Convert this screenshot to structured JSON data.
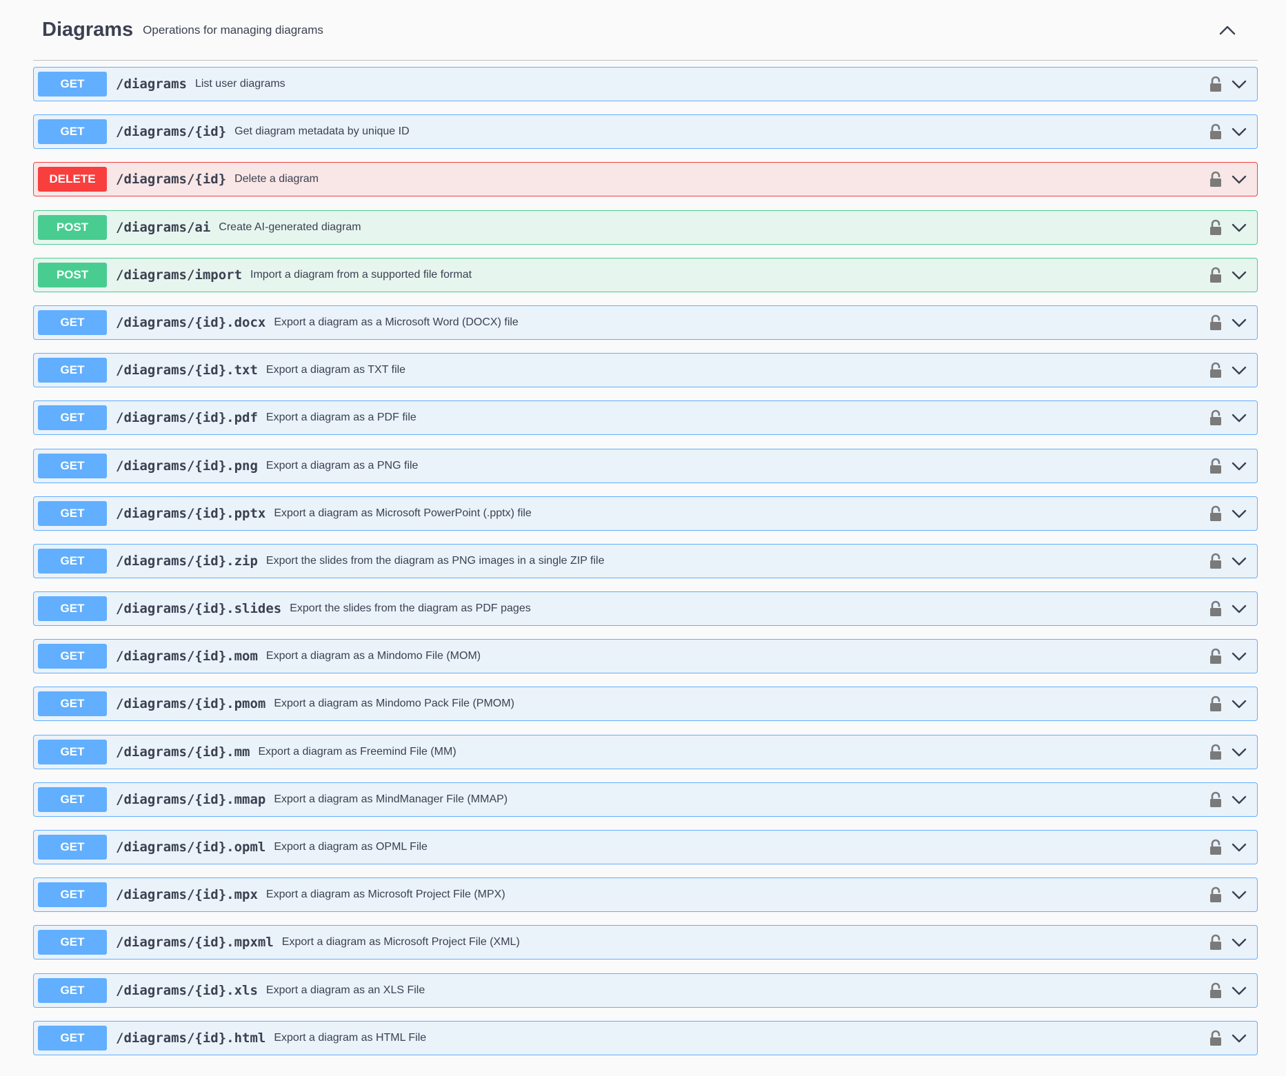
{
  "section": {
    "title": "Diagrams",
    "description": "Operations for managing diagrams"
  },
  "colors": {
    "get": "#61affe",
    "delete": "#f93e3e",
    "post": "#49cc90",
    "text": "#3b4151"
  },
  "operations": [
    {
      "method": "GET",
      "path": "/diagrams",
      "summary": "List user diagrams"
    },
    {
      "method": "GET",
      "path": "/diagrams/{id}",
      "summary": "Get diagram metadata by unique ID"
    },
    {
      "method": "DELETE",
      "path": "/diagrams/{id}",
      "summary": "Delete a diagram"
    },
    {
      "method": "POST",
      "path": "/diagrams/ai",
      "summary": "Create AI-generated diagram"
    },
    {
      "method": "POST",
      "path": "/diagrams/import",
      "summary": "Import a diagram from a supported file format"
    },
    {
      "method": "GET",
      "path": "/diagrams/{id}.docx",
      "summary": "Export a diagram as a Microsoft Word (DOCX) file"
    },
    {
      "method": "GET",
      "path": "/diagrams/{id}.txt",
      "summary": "Export a diagram as TXT file"
    },
    {
      "method": "GET",
      "path": "/diagrams/{id}.pdf",
      "summary": "Export a diagram as a PDF file"
    },
    {
      "method": "GET",
      "path": "/diagrams/{id}.png",
      "summary": "Export a diagram as a PNG file"
    },
    {
      "method": "GET",
      "path": "/diagrams/{id}.pptx",
      "summary": "Export a diagram as Microsoft PowerPoint (.pptx) file"
    },
    {
      "method": "GET",
      "path": "/diagrams/{id}.zip",
      "summary": "Export the slides from the diagram as PNG images in a single ZIP file"
    },
    {
      "method": "GET",
      "path": "/diagrams/{id}.slides",
      "summary": "Export the slides from the diagram as PDF pages"
    },
    {
      "method": "GET",
      "path": "/diagrams/{id}.mom",
      "summary": "Export a diagram as a Mindomo File (MOM)"
    },
    {
      "method": "GET",
      "path": "/diagrams/{id}.pmom",
      "summary": "Export a diagram as Mindomo Pack File (PMOM)"
    },
    {
      "method": "GET",
      "path": "/diagrams/{id}.mm",
      "summary": "Export a diagram as Freemind File (MM)"
    },
    {
      "method": "GET",
      "path": "/diagrams/{id}.mmap",
      "summary": "Export a diagram as MindManager File (MMAP)"
    },
    {
      "method": "GET",
      "path": "/diagrams/{id}.opml",
      "summary": "Export a diagram as OPML File"
    },
    {
      "method": "GET",
      "path": "/diagrams/{id}.mpx",
      "summary": "Export a diagram as Microsoft Project File (MPX)"
    },
    {
      "method": "GET",
      "path": "/diagrams/{id}.mpxml",
      "summary": "Export a diagram as Microsoft Project File (XML)"
    },
    {
      "method": "GET",
      "path": "/diagrams/{id}.xls",
      "summary": "Export a diagram as an XLS File"
    },
    {
      "method": "GET",
      "path": "/diagrams/{id}.html",
      "summary": "Export a diagram as HTML File"
    }
  ]
}
